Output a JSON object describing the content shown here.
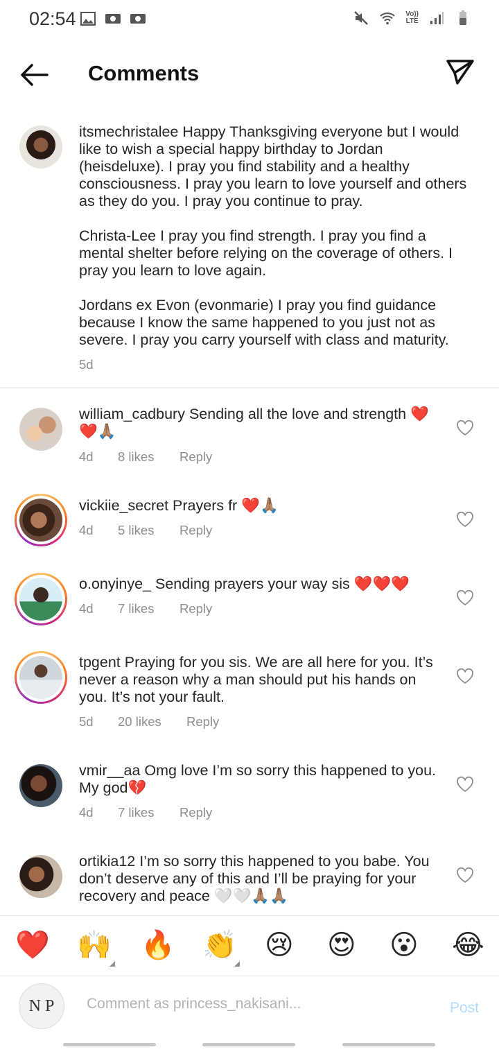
{
  "status_bar": {
    "time": "02:54",
    "lte_top": "Vo))",
    "lte_bottom": "LTE"
  },
  "header": {
    "title": "Comments"
  },
  "caption": {
    "username": "itsmechristalee",
    "text": "Happy Thanksgiving everyone but I would like to wish a special happy birthday to Jordan (heisdeluxe). I pray you find stability and a healthy consciousness. I pray you learn to love yourself and others as they do you. I pray you continue to pray.",
    "para2": "Christa-Lee I pray you find strength. I pray you find a mental shelter before relying on the coverage of others. I pray you learn to love again.",
    "para3": "Jordans ex Evon (evonmarie) I pray you find guidance because I know the same happened to you just not as severe. I pray you carry yourself with class and maturity.",
    "time": "5d"
  },
  "comments": [
    {
      "username": "william_cadbury",
      "text": "Sending all the love and strength ❤️ ❤️🙏🏽",
      "time": "4d",
      "likes": "8 likes",
      "reply": "Reply"
    },
    {
      "username": "vickiie_secret",
      "text": "Prayers fr ❤️🙏🏽",
      "time": "4d",
      "likes": "5 likes",
      "reply": "Reply"
    },
    {
      "username": "o.onyinye_",
      "text": "Sending prayers your way sis ❤️❤️❤️",
      "time": "4d",
      "likes": "7 likes",
      "reply": "Reply"
    },
    {
      "username": "tpgent",
      "text": "Praying for you sis. We are all here for you. It’s never a reason why a man should put his hands on you. It’s not your fault.",
      "time": "5d",
      "likes": "20 likes",
      "reply": "Reply"
    },
    {
      "username": "vmir__aa",
      "text": "Omg love I’m so sorry this happened to you. My god💔",
      "time": "4d",
      "likes": "7 likes",
      "reply": "Reply"
    },
    {
      "username": "ortikia12",
      "text": "I’m so sorry this happened to you babe. You don’t deserve any of this and I’ll be praying for your recovery and peace 🤍🤍🙏🏽🙏🏽"
    }
  ],
  "emoji_bar": [
    "❤️",
    "🙌",
    "🔥",
    "👏",
    "😢",
    "😍",
    "😮",
    "😂"
  ],
  "composer": {
    "avatar_initials": "N P",
    "placeholder": "Comment as princess_nakisani...",
    "post": "Post"
  },
  "colors": {
    "link_post": "#b3dbff",
    "meta": "#8e8e8e",
    "heart_red": "#ed4956"
  }
}
